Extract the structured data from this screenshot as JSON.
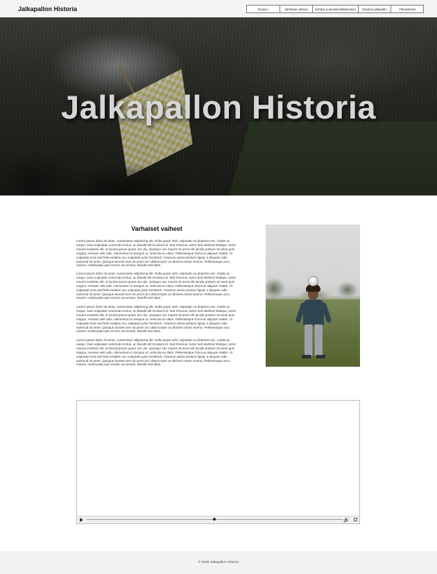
{
  "header": {
    "brand": "Jalkapallon Historia",
    "nav": [
      "Etusivu",
      "Varhaiset vaiheet",
      "Kehitys & kansainvälistyminen",
      "Moderni jalkapallo",
      "Yhteystiedot"
    ]
  },
  "hero": {
    "title": "Jalkapallon Historia"
  },
  "article": {
    "title": "Varhaiset vaiheet",
    "paragraphs": [
      "Lorem ipsum dolor sit amet, consectetur adipiscing elit. Nulla quam velit, vulputate eu pharetra nec, mattis ac neque. Duis vulputate commodo lectus, ac blandit elit tincidunt id. Sed rhoncus, tortor sed eleifend tristique, tortor mauris molestie elit, et lacinia ipsum quam nec dui. Quisque nec mauris sit amet elit iaculis pretium sit amet quis magna. Aenean velit odio, elementum in tempus ut, vehicula eu diam. Pellentesque rhoncus aliquam mattis. Ut vulputate eros sed felis sodales nec vulputate justo hendrerit. Vivamus varius pretium ligula, a aliquam odio euismod sit amet. Quisque laoreet sem sit amet orci ullamcorper at ultricies metus viverra. Pellentesque arcu mauris, malesuada quis ornare accumsan, blandit sed diam.",
      "Lorem ipsum dolor sit amet, consectetur adipiscing elit. Nulla quam velit, vulputate eu pharetra nec, mattis ac neque. Duis vulputate commodo lectus, ac blandit elit tincidunt id. Sed rhoncus, tortor sed eleifend tristique, tortor mauris molestie elit, et lacinia ipsum quam nec dui. Quisque nec mauris sit amet elit iaculis pretium sit amet quis magna. Aenean velit odio, elementum in tempus ut, vehicula eu diam. Pellentesque rhoncus aliquam mattis. Ut vulputate eros sed felis sodales nec vulputate justo hendrerit. Vivamus varius pretium ligula, a aliquam odio euismod sit amet. Quisque laoreet sem sit amet orci ullamcorper at ultricies metus viverra. Pellentesque arcu mauris, malesuada quis ornare accumsan, blandit sed diam.",
      "Lorem ipsum dolor sit amet, consectetur adipiscing elit. Nulla quam velit, vulputate eu pharetra nec, mattis ac neque. Duis vulputate commodo lectus, ac blandit elit tincidunt id. Sed rhoncus, tortor sed eleifend tristique, tortor mauris molestie elit, et lacinia ipsum quam nec dui. Quisque nec mauris sit amet elit iaculis pretium sit amet quis magna. Aenean velit odio, elementum in tempus ut, vehicula eu diam. Pellentesque rhoncus aliquam mattis. Ut vulputate eros sed felis sodales nec vulputate justo hendrerit. Vivamus varius pretium ligula, a aliquam odio euismod sit amet. Quisque laoreet sem sit amet orci ullamcorper at ultricies metus viverra. Pellentesque arcu mauris, malesuada quis ornare accumsan, blandit sed diam.",
      "Lorem ipsum dolor sit amet, consectetur adipiscing elit. Nulla quam velit, vulputate eu pharetra nec, mattis ac neque. Duis vulputate commodo lectus, ac blandit elit tincidunt id. Sed rhoncus, tortor sed eleifend tristique, tortor mauris molestie elit, et lacinia ipsum quam nec dui. Quisque nec mauris sit amet elit iaculis pretium sit amet quis magna. Aenean velit odio, elementum in tempus ut, vehicula eu diam. Pellentesque rhoncus aliquam mattis. Ut vulputate eros sed felis sodales nec vulputate justo hendrerit. Vivamus varius pretium ligula, a aliquam odio euismod sit amet. Quisque laoreet sem sit amet orci ullamcorper at ultricies metus viverra. Pellentesque arcu mauris, malesuada quis ornare accumsan, blandit sed diam."
    ]
  },
  "video": {
    "controls": {
      "play_icon": "play-icon",
      "volume_icon": "volume-icon",
      "fullscreen_icon": "fullscreen-icon",
      "volume_glyph": "🔊"
    }
  },
  "footer": {
    "text": "© 2025 Jalkapallon Historia"
  }
}
